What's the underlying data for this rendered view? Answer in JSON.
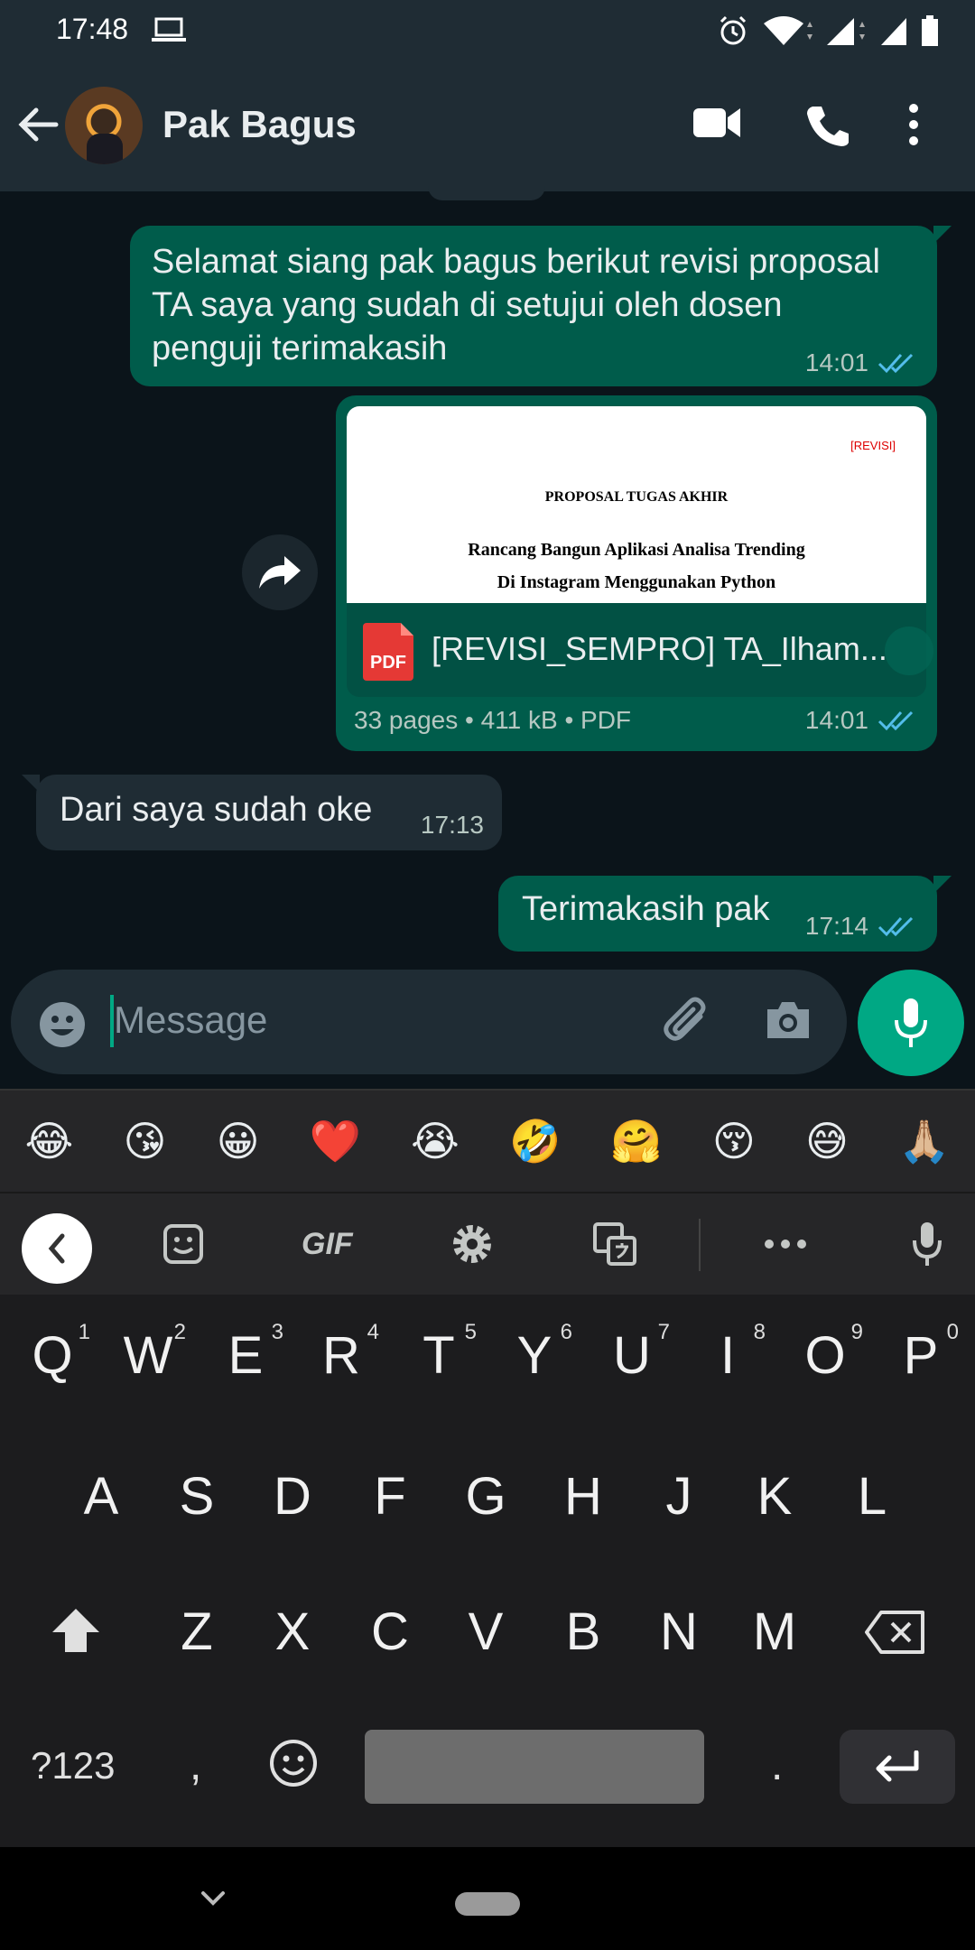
{
  "status_bar": {
    "time": "17:48"
  },
  "header": {
    "contact_name": "Pak Bagus"
  },
  "messages": [
    {
      "text": "Selamat siang pak bagus berikut revisi proposal TA saya yang sudah di setujui oleh dosen penguji terimakasih",
      "time": "14:01"
    },
    {
      "document": {
        "preview_tag": "[REVISI]",
        "preview_heading": "PROPOSAL TUGAS AKHIR",
        "preview_title_line1": "Rancang Bangun Aplikasi Analisa Trending",
        "preview_title_line2": "Di Instagram Menggunakan Python",
        "icon_label": "PDF",
        "file_name": "[REVISI_SEMPRO] TA_Ilham...",
        "info": "33 pages • 411 kB • PDF"
      },
      "time": "14:01"
    },
    {
      "text": "Dari saya sudah oke",
      "time": "17:13"
    },
    {
      "text": "Terimakasih pak",
      "time": "17:14"
    }
  ],
  "composer": {
    "placeholder": "Message"
  },
  "keyboard": {
    "emoji_suggestions": [
      "😂",
      "😘",
      "😀",
      "❤️",
      "😭",
      "🤣",
      "🤗",
      "😚",
      "😅",
      "🙏🏼"
    ],
    "gif_label": "GIF",
    "row1": [
      "Q",
      "W",
      "E",
      "R",
      "T",
      "Y",
      "U",
      "I",
      "O",
      "P"
    ],
    "row1_numbers": [
      "1",
      "2",
      "3",
      "4",
      "5",
      "6",
      "7",
      "8",
      "9",
      "0"
    ],
    "row2": [
      "A",
      "S",
      "D",
      "F",
      "G",
      "H",
      "J",
      "K",
      "L"
    ],
    "row3": [
      "Z",
      "X",
      "C",
      "V",
      "B",
      "N",
      "M"
    ],
    "symbols_label": "?123",
    "comma": ",",
    "period": "."
  },
  "colors": {
    "accent": "#00a884",
    "outgoing_bubble": "#005c4b",
    "incoming_bubble": "#1f2c34",
    "read_ticks": "#53bdeb"
  }
}
